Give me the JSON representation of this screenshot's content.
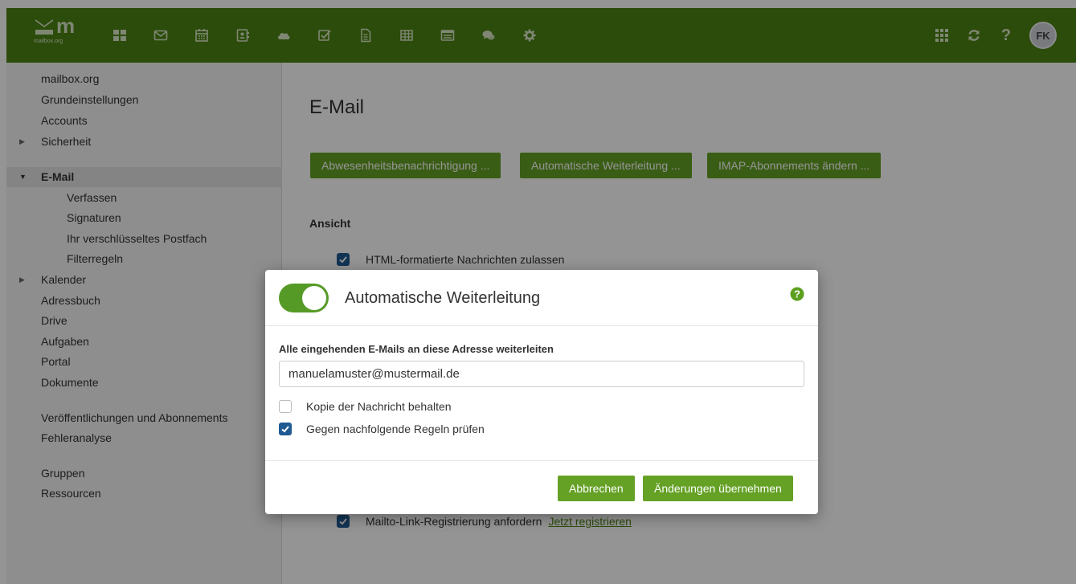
{
  "header": {
    "logo_text": "m",
    "logo_sub": "mailbox.org",
    "apps": [
      {
        "name": "portal-icon"
      },
      {
        "name": "mail-icon"
      },
      {
        "name": "calendar-icon"
      },
      {
        "name": "addressbook-icon"
      },
      {
        "name": "drive-icon"
      },
      {
        "name": "tasks-icon"
      },
      {
        "name": "document-icon"
      },
      {
        "name": "spreadsheet-icon"
      },
      {
        "name": "presentation-icon"
      },
      {
        "name": "chat-icon"
      },
      {
        "name": "settings-icon"
      }
    ],
    "right_tools": [
      "app-launcher-icon",
      "refresh-icon",
      "help-icon"
    ],
    "help_glyph": "?",
    "avatar_initials": "FK",
    "bar_color": "#4c8413"
  },
  "sidebar": {
    "items": [
      {
        "label": "mailbox.org",
        "level": 0,
        "caret": ""
      },
      {
        "label": "Grundeinstellungen",
        "level": 0,
        "caret": ""
      },
      {
        "label": "Accounts",
        "level": 0,
        "caret": ""
      },
      {
        "label": "Sicherheit",
        "level": 0,
        "caret": "▶"
      },
      {
        "label": "E-Mail",
        "level": 0,
        "caret": "▼",
        "active": true
      },
      {
        "label": "Verfassen",
        "level": 1,
        "caret": ""
      },
      {
        "label": "Signaturen",
        "level": 1,
        "caret": ""
      },
      {
        "label": "Ihr verschlüsseltes Postfach",
        "level": 1,
        "caret": ""
      },
      {
        "label": "Filterregeln",
        "level": 1,
        "caret": ""
      },
      {
        "label": "Kalender",
        "level": 0,
        "caret": "▶"
      },
      {
        "label": "Adressbuch",
        "level": 0,
        "caret": ""
      },
      {
        "label": "Drive",
        "level": 0,
        "caret": ""
      },
      {
        "label": "Aufgaben",
        "level": 0,
        "caret": ""
      },
      {
        "label": "Portal",
        "level": 0,
        "caret": ""
      },
      {
        "label": "Dokumente",
        "level": 0,
        "caret": ""
      },
      {
        "label": "Veröffentlichungen und Abonnements",
        "level": 0,
        "caret": ""
      },
      {
        "label": "Fehleranalyse",
        "level": 0,
        "caret": ""
      },
      {
        "label": "Gruppen",
        "level": 0,
        "caret": ""
      },
      {
        "label": "Ressourcen",
        "level": 0,
        "caret": ""
      }
    ]
  },
  "main": {
    "title": "E-Mail",
    "buttons": [
      "Abwesenheitsbenachrichtigung ...",
      "Automatische Weiterleitung ...",
      "IMAP-Abonnements ändern ..."
    ],
    "section_title": "Ansicht",
    "options": [
      {
        "label": "HTML-formatierte Nachrichten zulassen",
        "checked": true
      },
      {
        "label": "Mailto-Link-Registrierung anfordern",
        "checked": true,
        "link": "Jetzt registrieren"
      }
    ]
  },
  "modal": {
    "title": "Automatische Weiterleitung",
    "enabled": true,
    "field_label": "Alle eingehenden E-Mails an diese Adresse weiterleiten",
    "address": "manuelamuster@mustermail.de",
    "options": [
      {
        "label": "Kopie der Nachricht behalten",
        "checked": false
      },
      {
        "label": "Gegen nachfolgende Regeln prüfen",
        "checked": true
      }
    ],
    "cancel_label": "Abbrechen",
    "apply_label": "Änderungen übernehmen"
  },
  "colors": {
    "primary_button": "#65a125",
    "checkbox": "#1f5a92",
    "help": "#5c9f1e"
  }
}
